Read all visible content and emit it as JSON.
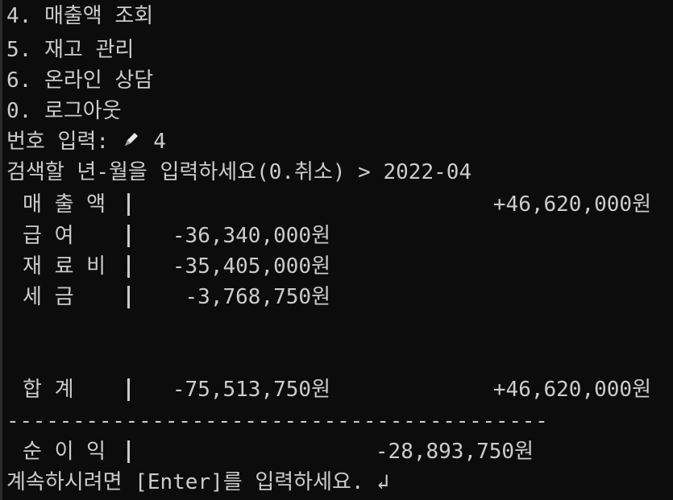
{
  "menu": [
    {
      "label": "4. 매출액 조회"
    },
    {
      "label": "5. 재고 관리"
    },
    {
      "label": "6. 온라인 상담"
    },
    {
      "label": "0. 로그아웃"
    }
  ],
  "prompt": {
    "label": "번호 입력: ",
    "value": "4",
    "icon": "pencil-icon"
  },
  "query": {
    "label": "검색할 년-월을 입력하세요(0.취소) > ",
    "value": "2022-04"
  },
  "rows": [
    {
      "label": "매 출 액",
      "expense": "",
      "income": "+46,620,000원"
    },
    {
      "label": "급 여",
      "expense": "-36,340,000원",
      "income": ""
    },
    {
      "label": "재 료 비",
      "expense": "-35,405,000원",
      "income": ""
    },
    {
      "label": "세 금",
      "expense": "-3,768,750원",
      "income": ""
    }
  ],
  "total": {
    "label": "합 계",
    "expense": "-75,513,750원",
    "income": "+46,620,000원"
  },
  "separator": "-----------------------------------------",
  "net": {
    "label": "순 이 익",
    "value": "-28,893,750원"
  },
  "footer": "계속하시려면 [Enter]를 입력하세요. ↲",
  "colors": {
    "background": "#0c0c0c",
    "text": "#cccccc"
  }
}
